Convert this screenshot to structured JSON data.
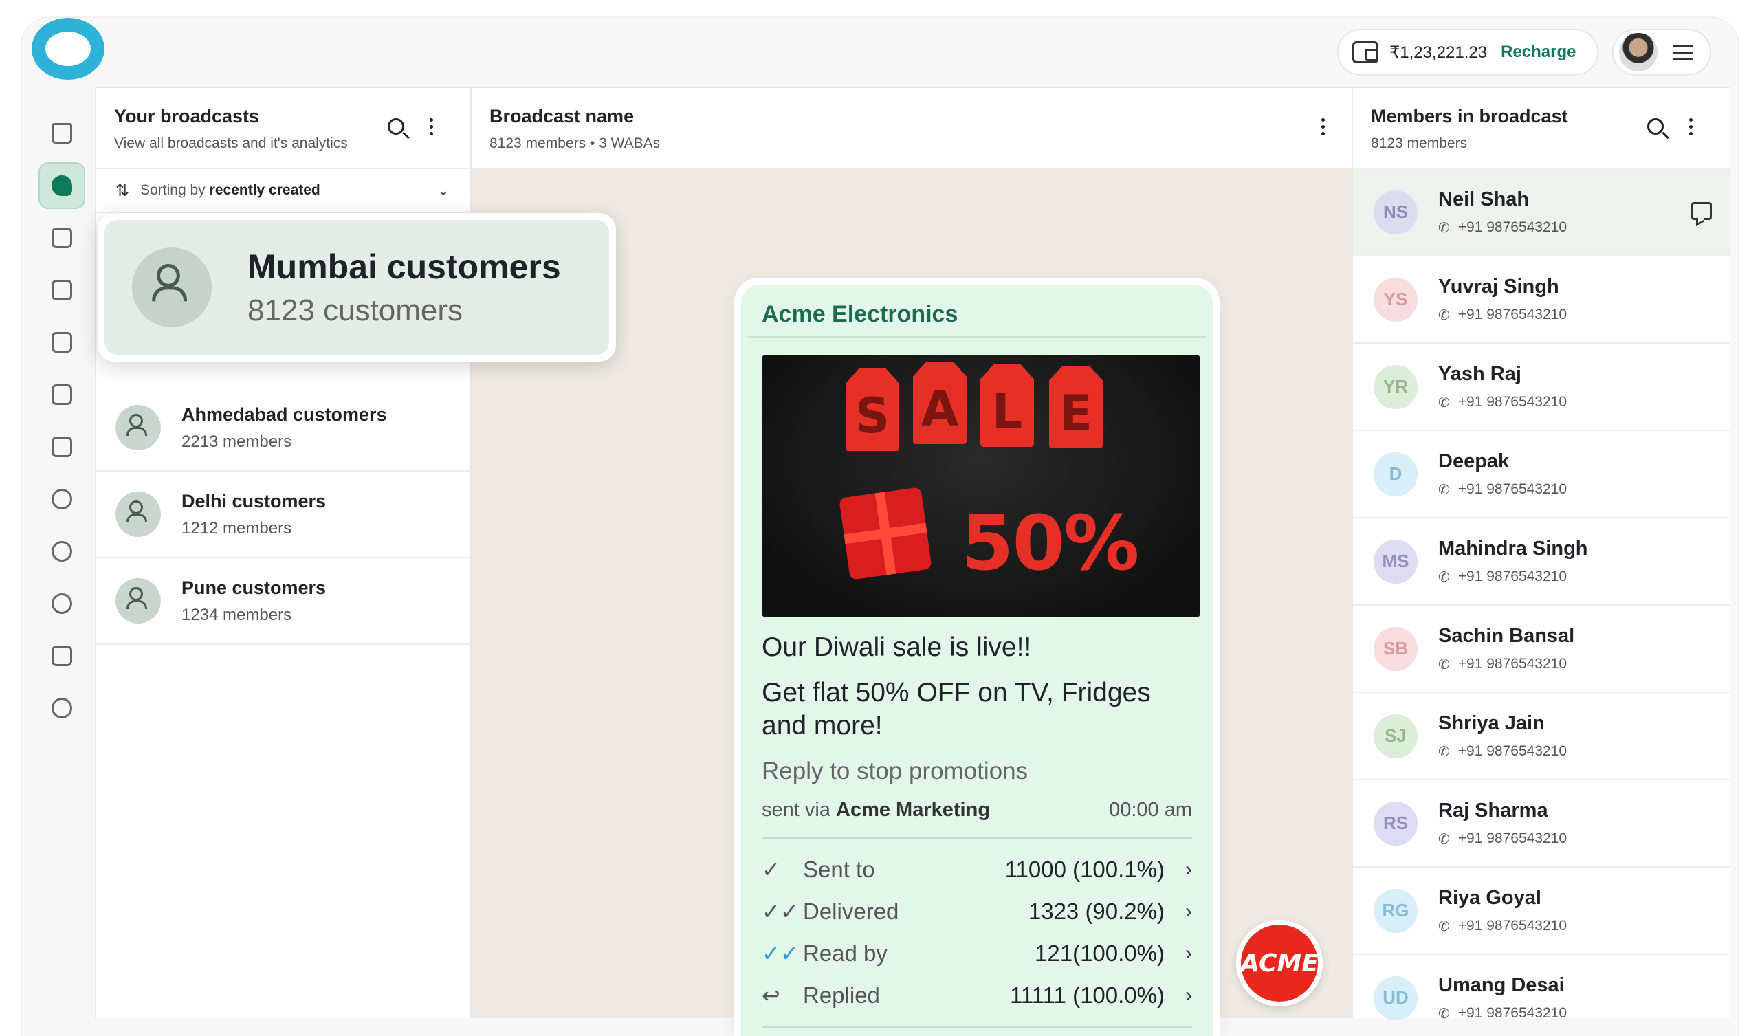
{
  "topbar": {
    "balance": "₹1,23,221.23",
    "recharge_label": "Recharge",
    "icons": [
      "wallet-icon",
      "avatar",
      "menu-icon"
    ]
  },
  "rail": {
    "items": [
      "home-icon",
      "broadcast-icon",
      "chat-add-icon",
      "calendar-icon",
      "analytics-icon",
      "contacts-icon",
      "integrations-icon",
      "team-icon",
      "bot-icon",
      "ai-icon",
      "timer-icon",
      "settings-icon"
    ],
    "active_index": 1
  },
  "broadcasts": {
    "title": "Your broadcasts",
    "subtitle": "View all broadcasts and it's analytics",
    "sort_prefix": "Sorting by",
    "sort_value": "recently created",
    "highlight": {
      "name": "Mumbai customers",
      "count": "8123 customers"
    },
    "items": [
      {
        "name": "Ahmedabad customers",
        "count": "2213 members"
      },
      {
        "name": "Delhi customers",
        "count": "1212 members"
      },
      {
        "name": "Pune customers",
        "count": "1234 members"
      }
    ]
  },
  "detail": {
    "title": "Broadcast name",
    "subtitle": "8123 members • 3 WABAs",
    "message": {
      "sender": "Acme Electronics",
      "image_tags": [
        "S",
        "A",
        "L",
        "E"
      ],
      "image_discount": "50%",
      "line1": "Our Diwali sale is live!!",
      "line2": "Get flat 50% OFF on TV, Fridges and more!",
      "footer": "Reply to stop promotions",
      "sent_via_prefix": "sent via",
      "sent_via_name": "Acme Marketing",
      "time": "00:00 am",
      "stats": [
        {
          "label": "Sent to",
          "value": "11000 (100.1%)",
          "icon": "✓"
        },
        {
          "label": "Delivered",
          "value": "1323 (90.2%)",
          "icon": "✓✓"
        },
        {
          "label": "Read by",
          "value": "121(100.0%)",
          "icon": "✓✓"
        },
        {
          "label": "Replied",
          "value": "11111 (100.0%)",
          "icon": "↩"
        }
      ]
    },
    "badge": "ACME"
  },
  "members": {
    "title": "Members in broadcast",
    "subtitle": "8123 members",
    "list": [
      {
        "initials": "NS",
        "name": "Neil Shah",
        "phone": "+91 9876543210",
        "bg": "#dcdcf0",
        "fg": "#8d8db8"
      },
      {
        "initials": "YS",
        "name": "Yuvraj Singh",
        "phone": "+91 9876543210",
        "bg": "#f8dde0",
        "fg": "#d99aa1"
      },
      {
        "initials": "YR",
        "name": "Yash Raj",
        "phone": "+91 9876543210",
        "bg": "#dcedd9",
        "fg": "#93b88c"
      },
      {
        "initials": "D",
        "name": "Deepak",
        "phone": "+91 9876543210",
        "bg": "#d8eef8",
        "fg": "#86bcd8"
      },
      {
        "initials": "MS",
        "name": "Mahindra Singh",
        "phone": "+91 9876543210",
        "bg": "#dedcf2",
        "fg": "#9390bf"
      },
      {
        "initials": "SB",
        "name": "Sachin Bansal",
        "phone": "+91 9876543210",
        "bg": "#f8dde0",
        "fg": "#d99aa1"
      },
      {
        "initials": "SJ",
        "name": "Shriya Jain",
        "phone": "+91 9876543210",
        "bg": "#dcedd9",
        "fg": "#93b88c"
      },
      {
        "initials": "RS",
        "name": "Raj Sharma",
        "phone": "+91 9876543210",
        "bg": "#dedcf2",
        "fg": "#9390bf"
      },
      {
        "initials": "RG",
        "name": "Riya Goyal",
        "phone": "+91 9876543210",
        "bg": "#d8eef8",
        "fg": "#86bcd8"
      },
      {
        "initials": "UD",
        "name": "Umang Desai",
        "phone": "+91 9876543210",
        "bg": "#d8eef8",
        "fg": "#86bcd8"
      }
    ]
  }
}
